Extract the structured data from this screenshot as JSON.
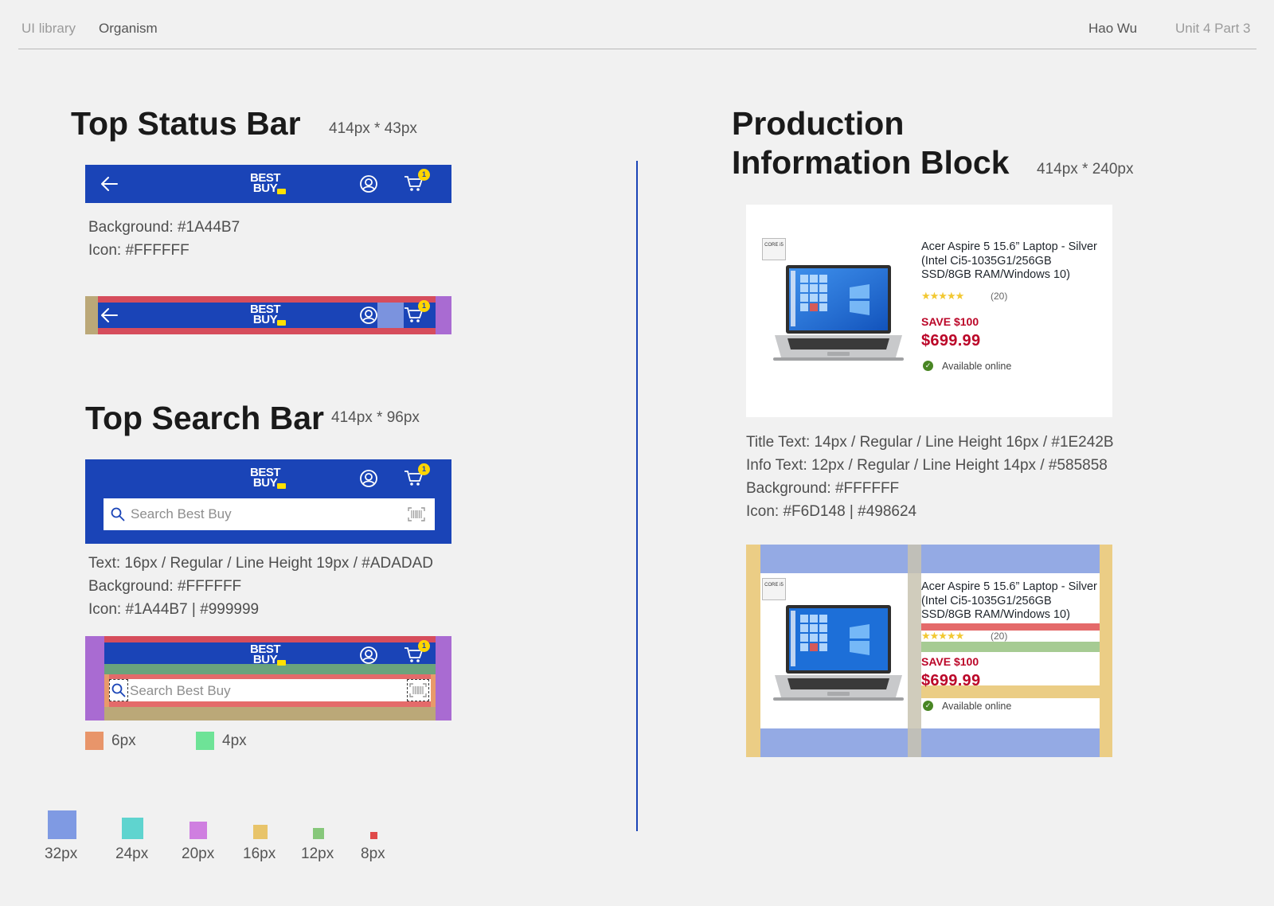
{
  "header": {
    "crumb_1": "UI library",
    "crumb_2": "Organism",
    "author": "Hao Wu",
    "unit": "Unit 4 Part 3"
  },
  "status_bar": {
    "title": "Top Status Bar",
    "dims": "414px * 43px",
    "spec_bg": "Background: #1A44B7",
    "spec_icon": "Icon: #FFFFFF",
    "logo_line1": "BEST",
    "logo_line2": "BUY",
    "cart_count": "1",
    "color": "#1A44B7"
  },
  "search_bar": {
    "title": "Top Search Bar",
    "dims": "414px * 96px",
    "placeholder": "Search Best Buy",
    "spec_text": "Text: 16px / Regular / Line Height 19px / #ADADAD",
    "spec_bg": "Background: #FFFFFF",
    "spec_icon": "Icon: #1A44B7 | #999999"
  },
  "spacing_legend_small": [
    {
      "label": "6px",
      "color": "#e8956a"
    },
    {
      "label": "4px",
      "color": "#6ee397"
    }
  ],
  "spacing_legend": [
    {
      "label": "32px",
      "color": "#7f9ae3"
    },
    {
      "label": "24px",
      "color": "#5fd4cf"
    },
    {
      "label": "20px",
      "color": "#cf7fe0"
    },
    {
      "label": "16px",
      "color": "#e8c46a"
    },
    {
      "label": "12px",
      "color": "#86c77a"
    },
    {
      "label": "8px",
      "color": "#e04a4a"
    }
  ],
  "product_block": {
    "title_line1": "Production",
    "title_line2": "Information Block",
    "dims": "414px * 240px",
    "product_title": "Acer Aspire 5 15.6” Laptop - Silver (Intel Ci5-1035G1/256GB SSD/8GB RAM/Windows 10)",
    "rating_stars": "★★★★★",
    "rating_count": "(20)",
    "save": "SAVE $100",
    "price": "$699.99",
    "availability": "Available online",
    "intel_badge": "CORE i5",
    "spec_title": "Title Text: 14px / Regular / Line Height 16px / #1E242B",
    "spec_info": "Info Text: 12px / Regular / Line Height 14px / #585858",
    "spec_bg": "Background: #FFFFFF",
    "spec_icon": "Icon: #F6D148 | #498624"
  }
}
